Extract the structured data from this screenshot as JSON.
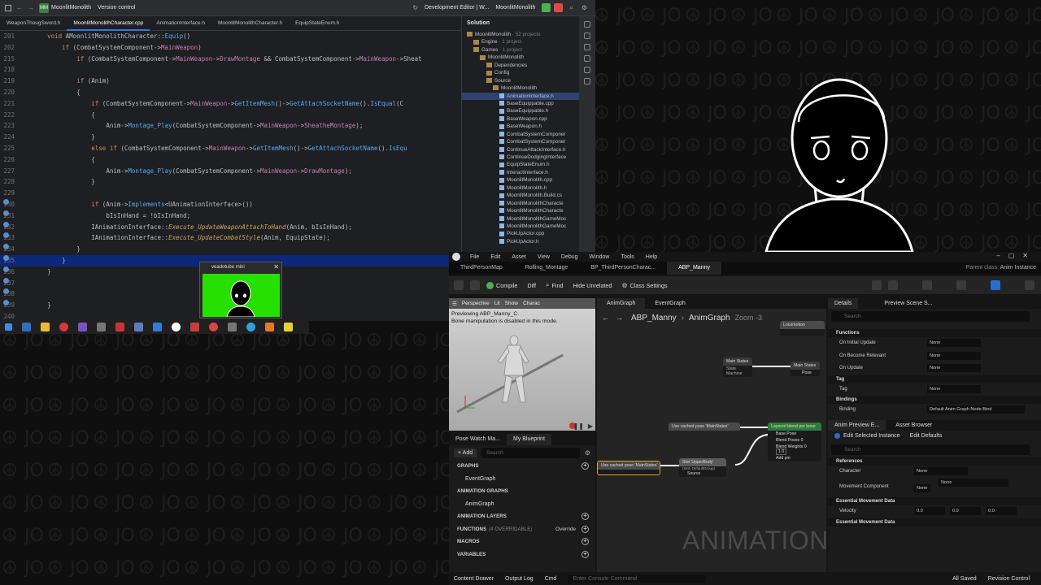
{
  "ide": {
    "toolbar": {
      "project": "MoonlitMonolith",
      "version_control": "Version control",
      "config": "Development Editor | W...",
      "target": "MoonlitMonolith"
    },
    "tabs": [
      "WeaponThougSword.h",
      "MoonlitMonolithCharacter.cpp",
      "AnimationInterface.h",
      "MoonlitMonolithCharacter.h",
      "EquipStateEnum.h"
    ],
    "active_tab": 1,
    "code_lines": [
      {
        "n": "201",
        "html": "    <span class='kw'>void</span> <span class='pl'>AMoonlitMonolithCharacter::</span><span class='fn'>Equip</span><span class='pl'>()</span>"
      },
      {
        "n": "202",
        "html": "        <span class='kw'>if</span> <span class='pl'>(CombatSystemComponent-&gt;</span><span class='ty'>MainWeapon</span><span class='pl'>)</span>"
      },
      {
        "n": "215",
        "html": "            <span class='kw'>if</span> <span class='pl'>(CombatSystemComponent-&gt;</span><span class='ty'>MainWeapon</span><span class='pl'>-&gt;</span><span class='ty'>DrawMontage</span> <span class='pl'>&amp;&amp; CombatSystemComponent-&gt;</span><span class='ty'>MainWeapon</span><span class='pl'>-&gt;Sheat</span>"
      },
      {
        "n": "218",
        "html": ""
      },
      {
        "n": "219",
        "html": "            <span class='kw'>if</span> <span class='pl'>(Anim)</span>"
      },
      {
        "n": "220",
        "html": "            <span class='pl'>{</span>"
      },
      {
        "n": "221",
        "html": "                <span class='kw'>if</span> <span class='pl'>(CombatSystemComponent-&gt;</span><span class='ty'>MainWeapon</span><span class='pl'>-&gt;</span><span class='fn'>GetItemMesh</span><span class='pl'>()-&gt;</span><span class='fn'>GetAttachSocketName</span><span class='pl'>().</span><span class='fn'>IsEqual</span><span class='pl'>(C</span>"
      },
      {
        "n": "222",
        "html": "                <span class='pl'>{</span>"
      },
      {
        "n": "223",
        "html": "                    <span class='pl'>Anim-&gt;</span><span class='fn'>Montage_Play</span><span class='pl'>(CombatSystemComponent-&gt;</span><span class='ty'>MainWeapon</span><span class='pl'>-&gt;</span><span class='ty'>SheatheMontage</span><span class='pl'>);</span>"
      },
      {
        "n": "224",
        "html": "                <span class='pl'>}</span>"
      },
      {
        "n": "225",
        "html": "                <span class='kw'>else if</span> <span class='pl'>(CombatSystemComponent-&gt;</span><span class='ty'>MainWeapon</span><span class='pl'>-&gt;</span><span class='fn'>GetItemMesh</span><span class='pl'>()-&gt;</span><span class='fn'>GetAttachSocketName</span><span class='pl'>().</span><span class='fn'>IsEqu</span>"
      },
      {
        "n": "226",
        "html": "                <span class='pl'>{</span>"
      },
      {
        "n": "227",
        "html": "                    <span class='pl'>Anim-&gt;</span><span class='fn'>Montage_Play</span><span class='pl'>(CombatSystemComponent-&gt;</span><span class='ty'>MainWeapon</span><span class='pl'>-&gt;</span><span class='ty'>DrawMontage</span><span class='pl'>);</span>"
      },
      {
        "n": "228",
        "html": "                <span class='pl'>}</span>"
      },
      {
        "n": "229",
        "html": ""
      },
      {
        "n": "230",
        "html": "                <span class='kw'>if</span> <span class='pl'>(Anim-&gt;</span><span class='fn'>Implements</span><span class='pl'>&lt;UAnimationInterface&gt;())</span>"
      },
      {
        "n": "231",
        "html": "                    <span class='pl'>bIsInHand = !bIsInHand;</span>"
      },
      {
        "n": "232",
        "html": "                <span class='pl'>IAnimationInterface::</span><span class='it'>Execute_UpdateWeaponAttachToHand</span><span class='pl'>(Anim, bIsInHand);</span>"
      },
      {
        "n": "233",
        "html": "                <span class='pl'>IAnimationInterface::</span><span class='it'>Execute_UpdateCombatStyle</span><span class='pl'>(Anim, EquipState);</span>"
      },
      {
        "n": "234",
        "html": "            <span class='pl'>}</span>"
      },
      {
        "n": "235",
        "html": "        <span class='pl'>}</span>"
      },
      {
        "n": "236",
        "html": "    <span class='pl'>}</span>"
      },
      {
        "n": "237",
        "html": ""
      },
      {
        "n": "238",
        "html": ""
      },
      {
        "n": "239",
        "html": "    <span class='pl'>}</span>"
      },
      {
        "n": "240",
        "html": ""
      }
    ],
    "highlight_line": "235"
  },
  "solution": {
    "title": "Solution",
    "items": [
      {
        "text": "MoonlitMonolith",
        "sub": " · 52 projects",
        "type": "fo",
        "indent": 0
      },
      {
        "text": "Engine",
        "sub": " · 1 project",
        "type": "fo",
        "indent": 1
      },
      {
        "text": "Games",
        "sub": " · 1 project",
        "type": "fo",
        "indent": 1
      },
      {
        "text": "MoonlitMonolith",
        "sub": "",
        "type": "fo",
        "indent": 2
      },
      {
        "text": "Dependencies",
        "sub": "",
        "type": "fo",
        "indent": 3
      },
      {
        "text": "Config",
        "sub": "",
        "type": "fo",
        "indent": 3
      },
      {
        "text": "Source",
        "sub": "",
        "type": "fo",
        "indent": 3
      },
      {
        "text": "MoonlitMonolith",
        "sub": "",
        "type": "fo",
        "indent": 4
      },
      {
        "text": "AnimationInterface.h",
        "sub": "",
        "type": "fi",
        "indent": 5,
        "sel": true
      },
      {
        "text": "BaseEquippable.cpp",
        "sub": "",
        "type": "fi",
        "indent": 5
      },
      {
        "text": "BaseEquippable.h",
        "sub": "",
        "type": "fi",
        "indent": 5
      },
      {
        "text": "BaseWeapon.cpp",
        "sub": "",
        "type": "fi",
        "indent": 5
      },
      {
        "text": "BaseWeapon.h",
        "sub": "",
        "type": "fi",
        "indent": 5
      },
      {
        "text": "CombatSystemComponer",
        "sub": "",
        "type": "fi",
        "indent": 5
      },
      {
        "text": "CombatSystemComponer",
        "sub": "",
        "type": "fi",
        "indent": 5
      },
      {
        "text": "ContinueAttackInterface.h",
        "sub": "",
        "type": "fi",
        "indent": 5
      },
      {
        "text": "ContinueDodgingInterface",
        "sub": "",
        "type": "fi",
        "indent": 5
      },
      {
        "text": "EquipStateEnum.h",
        "sub": "",
        "type": "fi",
        "indent": 5
      },
      {
        "text": "InteractInterface.h",
        "sub": "",
        "type": "fi",
        "indent": 5
      },
      {
        "text": "MoonlitMonolith.cpp",
        "sub": "",
        "type": "fi",
        "indent": 5
      },
      {
        "text": "MoonlitMonolith.h",
        "sub": "",
        "type": "fi",
        "indent": 5
      },
      {
        "text": "MoonlitMonolith.Build.cs",
        "sub": "",
        "type": "fi",
        "indent": 5
      },
      {
        "text": "MoonlitMonolithCharacte",
        "sub": "",
        "type": "fi",
        "indent": 5
      },
      {
        "text": "MoonlitMonolithCharacte",
        "sub": "",
        "type": "fi",
        "indent": 5
      },
      {
        "text": "MoonlitMonolithGameMoc",
        "sub": "",
        "type": "fi",
        "indent": 5
      },
      {
        "text": "MoonlitMonolithGameMoc",
        "sub": "",
        "type": "fi",
        "indent": 5
      },
      {
        "text": "PickUpActor.cpp",
        "sub": "",
        "type": "fi",
        "indent": 5
      },
      {
        "text": "PickUpActor.h",
        "sub": "",
        "type": "fi",
        "indent": 5
      }
    ]
  },
  "vmini": {
    "title": "veadotube mini"
  },
  "unreal": {
    "menu": [
      "File",
      "Edit",
      "Asset",
      "View",
      "Debug",
      "Window",
      "Tools",
      "Help"
    ],
    "tabs": [
      "ThirdPersonMap",
      "Rolling_Montage",
      "BP_ThirdPersonCharac...",
      "ABP_Manny"
    ],
    "parent_class_label": "Parent class:",
    "parent_class_value": "Anim Instance",
    "toolbar": {
      "compile": "Compile",
      "diff": "Diff",
      "find": "Find",
      "hide_unrelated": "Hide Unrelated",
      "class_settings": "Class Settings"
    },
    "viewport": {
      "perspective": "Perspective",
      "lit": "Lit",
      "show": "Show",
      "character": "Charac",
      "line1": "Previewing ABP_Manny_C.",
      "line2": "Bone manipulation is disabled in this mode."
    },
    "bp_tabs": [
      "Pose Watch Ma...",
      "My Blueprint"
    ],
    "bp_add": "+ Add",
    "bp_search": "Search",
    "bp_sections": [
      {
        "kind": "sec",
        "text": "GRAPHS",
        "plus": true
      },
      {
        "kind": "item",
        "text": "EventGraph"
      },
      {
        "kind": "sec",
        "text": "ANIMATION GRAPHS",
        "plus": false
      },
      {
        "kind": "item",
        "text": "AnimGraph"
      },
      {
        "kind": "sec",
        "text": "ANIMATION LAYERS",
        "plus": true
      },
      {
        "kind": "sec",
        "text": "FUNCTIONS",
        "sub": "(4 OVERRIDABLE)",
        "override": "Override",
        "plus": true
      },
      {
        "kind": "sec",
        "text": "MACROS",
        "plus": true
      },
      {
        "kind": "sec",
        "text": "VARIABLES",
        "plus": true
      }
    ],
    "graph": {
      "tabs": [
        "AnimGraph",
        "EventGraph"
      ],
      "crumb_a": "ABP_Manny",
      "crumb_b": "AnimGraph",
      "zoom": "Zoom -3",
      "nodes": {
        "main_states": "Main States",
        "main_states_sub": "State Machine",
        "main_states_2": "Main States",
        "pose": "Pose",
        "use_cached": "Use cached pose 'MainStates'",
        "use_cached_2": "Use cached pose 'MainStates'",
        "slot": "Slot 'UpperBody'",
        "slot_sub": "(Slot: DefaultGroup)",
        "source": "Source",
        "layered": "Layered blend per bone",
        "base_pose": "Base Pose",
        "blend_poses": "Blend Poses 0",
        "blend_weights": "Blend Weights 0",
        "blend_val": "1.0",
        "add_pin": "Add pin",
        "locomotion": "Locomotion"
      },
      "watermark": "ANIMATION"
    },
    "details": {
      "tabs": [
        "Details",
        "Preview Scene S..."
      ],
      "search": "Search",
      "sec_functions": "Functions",
      "rows": [
        {
          "label": "On Initial Update",
          "value": "None"
        },
        {
          "label": "On Become Relevant",
          "value": "None"
        },
        {
          "label": "On Update",
          "value": "None"
        }
      ],
      "sec_tag": "Tag",
      "tag_label": "Tag",
      "tag_value": "None",
      "sec_bindings": "Bindings",
      "binding_label": "Binding",
      "binding_value": "Default Anim Graph Node Bind",
      "tabs2": [
        "Anim Preview E...",
        "Asset Browser"
      ],
      "edit_selected": "Edit Selected Instance",
      "edit_defaults": "Edit Defaults",
      "search2": "Search",
      "sec_references": "References",
      "character_label": "Character",
      "character_value": "None",
      "movement_label": "Movement Component",
      "movement_value": "None",
      "movement_value2": "None",
      "sec_essential": "Essential Movement Data",
      "velocity_label": "Velocity",
      "velocity": [
        "0.0",
        "0.0",
        "0.0"
      ],
      "sec_essential2": "Essential Movement Data"
    },
    "status": {
      "content_drawer": "Content Drawer",
      "output_log": "Output Log",
      "cmd": "Cmd",
      "console": "Enter Console Command",
      "saved": "All Saved",
      "revision": "Revision Control"
    }
  },
  "colors": {
    "accent": "#3574f0",
    "vmini_green": "#25e000",
    "highlight": "#0f2778"
  }
}
